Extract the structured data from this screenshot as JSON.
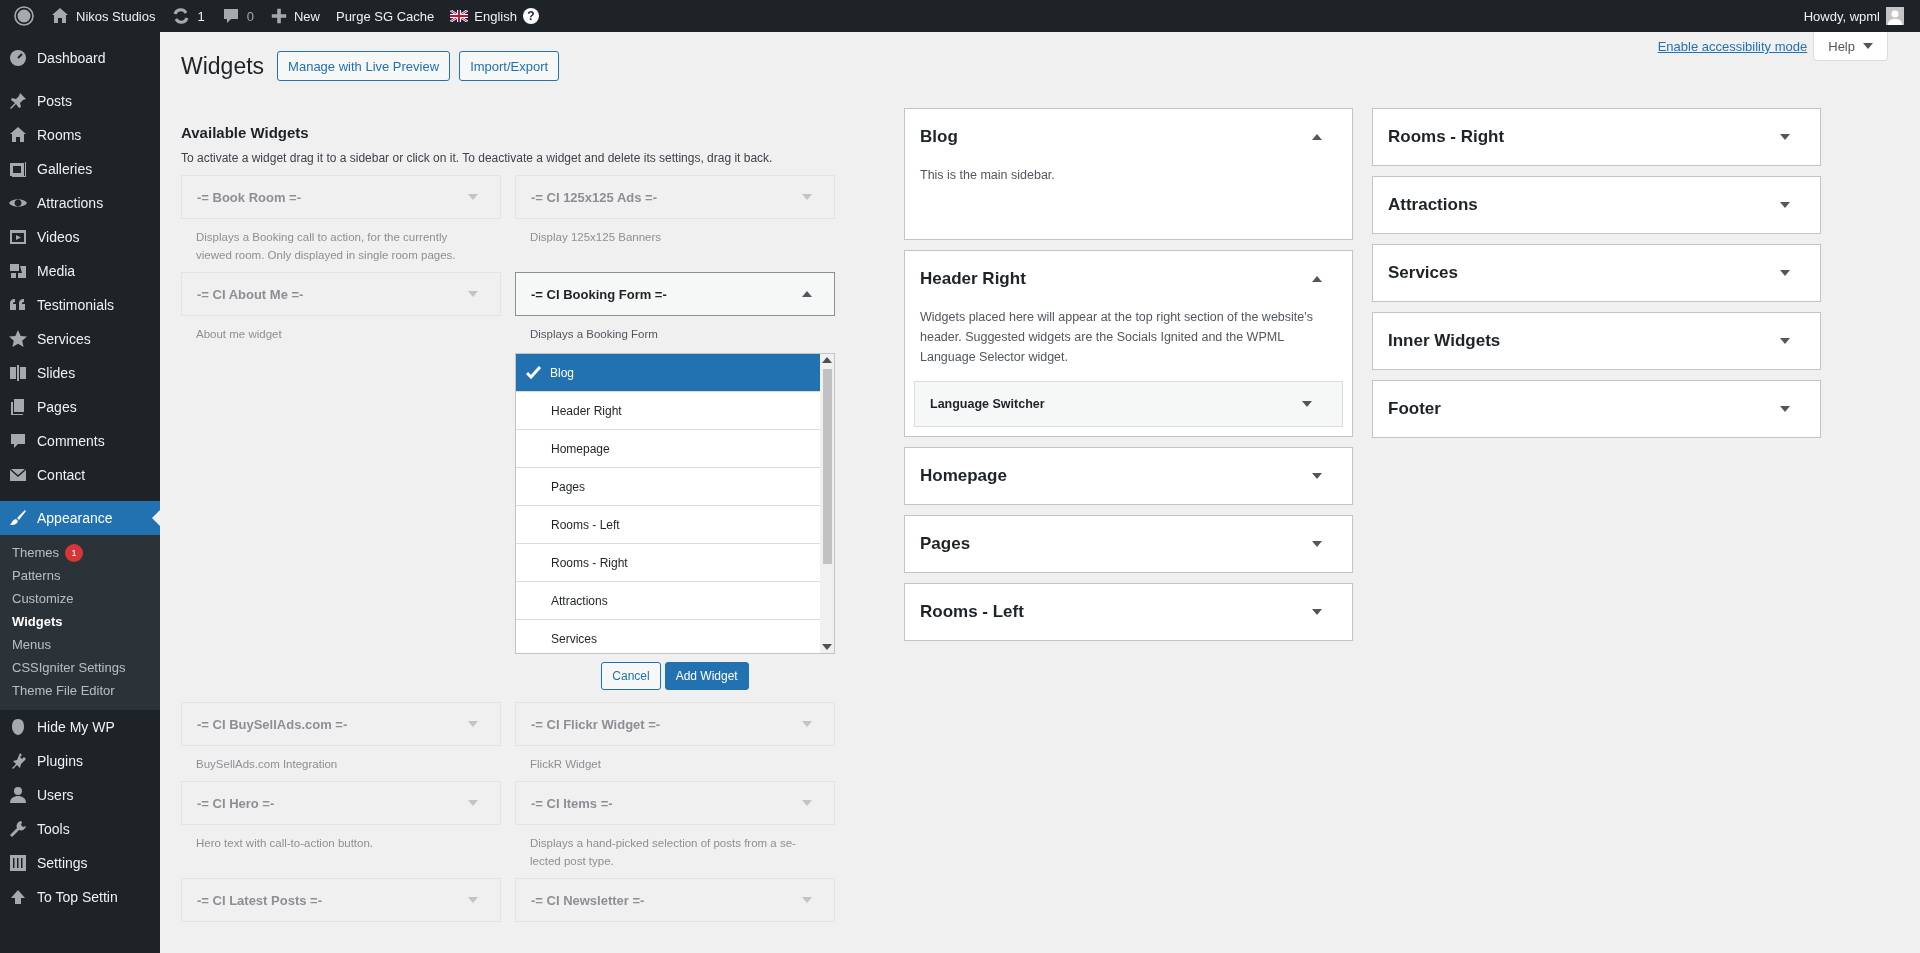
{
  "admin_bar": {
    "site": "Nikos Studios",
    "updates": "1",
    "comments": "0",
    "new": "New",
    "purge": "Purge SG Cache",
    "language": "English",
    "help_badge": "?",
    "howdy": "Howdy, wpml"
  },
  "menu_groups": [
    {
      "items": [
        {
          "label": "Dashboard",
          "selected": false
        }
      ]
    },
    {
      "items": [
        {
          "label": "Posts",
          "selected": false
        },
        {
          "label": "Rooms",
          "selected": false
        },
        {
          "label": "Galleries",
          "selected": false
        },
        {
          "label": "Attractions",
          "selected": false
        },
        {
          "label": "Videos",
          "selected": false
        },
        {
          "label": "Media",
          "selected": false
        },
        {
          "label": "Testimonials",
          "selected": false
        },
        {
          "label": "Services",
          "selected": false
        },
        {
          "label": "Slides",
          "selected": false
        },
        {
          "label": "Pages",
          "selected": false
        },
        {
          "label": "Comments",
          "selected": false
        },
        {
          "label": "Contact",
          "selected": false
        }
      ]
    },
    {
      "items": [
        {
          "label": "Appearance",
          "selected": true,
          "children": [
            {
              "label": "Themes",
              "badge": "1",
              "selected": false
            },
            {
              "label": "Patterns",
              "selected": false
            },
            {
              "label": "Customize",
              "selected": false
            },
            {
              "label": "Widgets",
              "selected": true
            },
            {
              "label": "Menus",
              "selected": false
            },
            {
              "label": "CSSIgniter Settings",
              "selected": false
            },
            {
              "label": "Theme File Editor",
              "selected": false
            }
          ]
        },
        {
          "label": "Hide My WP",
          "selected": false
        },
        {
          "label": "Plugins",
          "selected": false
        },
        {
          "label": "Users",
          "selected": false
        },
        {
          "label": "Tools",
          "selected": false
        },
        {
          "label": "Settings",
          "selected": false
        },
        {
          "label": "To Top Settin",
          "selected": false
        }
      ]
    }
  ],
  "screen_meta": {
    "accessibility_link": "Enable accessibility mode",
    "help": "Help"
  },
  "page": {
    "title": "Widgets",
    "buttons": [
      "Manage with Live Preview",
      "Import/Export"
    ]
  },
  "available": {
    "title": "Available Widgets",
    "description": "To activate a widget drag it to a sidebar or click on it. To deactivate a widget and delete its settings, drag it back.",
    "widgets": [
      {
        "title": "-= Book Room =-",
        "description": "Displays a Booking call to action, for the currently viewed room. Only displayed in single room pages.",
        "disabled": true,
        "expanded": false
      },
      {
        "title": "-= CI 125x125 Ads =-",
        "description": "Display 125x125 Banners",
        "disabled": true,
        "expanded": false
      },
      {
        "title": "-= CI About Me =-",
        "description": "About me widget",
        "disabled": true,
        "expanded": false
      },
      {
        "title": "-= CI Booking Form =-",
        "description": "Displays a Booking Form",
        "disabled": false,
        "expanded": true,
        "chooser": {
          "options": [
            {
              "label": "Blog",
              "selected": true
            },
            {
              "label": "Header Right",
              "selected": false
            },
            {
              "label": "Homepage",
              "selected": false
            },
            {
              "label": "Pages",
              "selected": false
            },
            {
              "label": "Rooms - Left",
              "selected": false
            },
            {
              "label": "Rooms - Right",
              "selected": false
            },
            {
              "label": "Attractions",
              "selected": false
            },
            {
              "label": "Services",
              "selected": false
            }
          ],
          "buttons": [
            {
              "label": "Cancel",
              "kind": "secondary"
            },
            {
              "label": "Add Widget",
              "kind": "primary"
            }
          ]
        }
      },
      {
        "title": "-= CI BuySellAds.com =-",
        "description": "BuySellAds.com Integration",
        "disabled": true,
        "expanded": false
      },
      {
        "title": "-= CI Flickr Widget =-",
        "description": "FlickR Widget",
        "disabled": true,
        "expanded": false
      },
      {
        "title": "-= CI Hero =-",
        "description": "Hero text with call-to-action button.",
        "disabled": true,
        "expanded": false
      },
      {
        "title": "-= CI Items =-",
        "description": "Displays a hand-picked selection of posts from a se-lected post type.",
        "disabled": true,
        "expanded": false
      },
      {
        "title": "-= CI Latest Posts =-",
        "disabled": true,
        "expanded": false
      },
      {
        "title": "-= CI Newsletter =-",
        "disabled": true,
        "expanded": false
      }
    ]
  },
  "sidebar_columns": [
    {
      "areas": [
        {
          "title": "Blog",
          "expanded": true,
          "description": "This is the main sidebar."
        },
        {
          "title": "Header Right",
          "expanded": true,
          "description": "Widgets placed here will appear at the top right section of the website's header. Suggested widgets are the Socials Ignited and the WPML Language Selector widget.",
          "widgets": [
            {
              "title": "Language Switcher"
            }
          ]
        },
        {
          "title": "Homepage",
          "expanded": false
        },
        {
          "title": "Pages",
          "expanded": false
        },
        {
          "title": "Rooms - Left",
          "expanded": false
        }
      ]
    },
    {
      "areas": [
        {
          "title": "Rooms - Right",
          "expanded": false
        },
        {
          "title": "Attractions",
          "expanded": false
        },
        {
          "title": "Services",
          "expanded": false
        },
        {
          "title": "Inner Widgets",
          "expanded": false
        },
        {
          "title": "Footer",
          "expanded": false
        }
      ]
    }
  ]
}
